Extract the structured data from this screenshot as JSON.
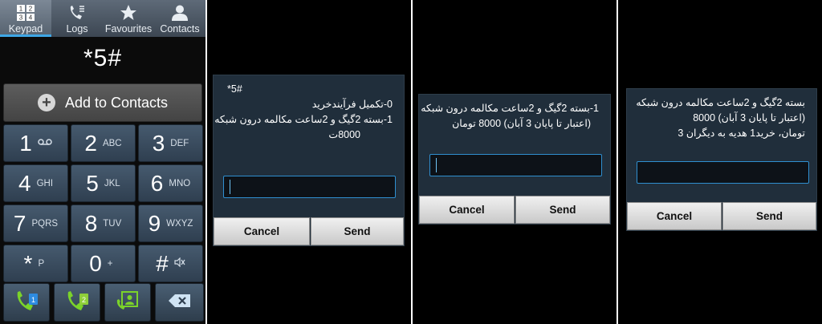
{
  "dialer": {
    "tabs": [
      {
        "label": "Keypad",
        "icon": "keypad-icon",
        "active": true
      },
      {
        "label": "Logs",
        "icon": "logs-icon",
        "active": false
      },
      {
        "label": "Favourites",
        "icon": "star-icon",
        "active": false
      },
      {
        "label": "Contacts",
        "icon": "person-icon",
        "active": false
      }
    ],
    "number": "*5#",
    "add_contacts_label": "Add to Contacts",
    "keys": [
      {
        "digit": "1",
        "letters": "voicemail"
      },
      {
        "digit": "2",
        "letters": "ABC"
      },
      {
        "digit": "3",
        "letters": "DEF"
      },
      {
        "digit": "4",
        "letters": "GHI"
      },
      {
        "digit": "5",
        "letters": "JKL"
      },
      {
        "digit": "6",
        "letters": "MNO"
      },
      {
        "digit": "7",
        "letters": "PQRS"
      },
      {
        "digit": "8",
        "letters": "TUV"
      },
      {
        "digit": "9",
        "letters": "WXYZ"
      },
      {
        "digit": "*",
        "letters": "P"
      },
      {
        "digit": "0",
        "letters": "+"
      },
      {
        "digit": "#",
        "letters": "mute"
      }
    ],
    "actions": [
      {
        "name": "call-sim1-button",
        "icon": "phone-sim1-icon",
        "badge": "1"
      },
      {
        "name": "call-sim2-button",
        "icon": "phone-sim2-icon",
        "badge": "2"
      },
      {
        "name": "video-call-button",
        "icon": "video-call-icon"
      },
      {
        "name": "backspace-button",
        "icon": "backspace-icon"
      }
    ],
    "colors": {
      "accent": "#3fa7e6",
      "call_green": "#7bd32a"
    }
  },
  "dialogs": [
    {
      "lines": [
        "*5#",
        "0-تکمیل فرآیندخرید",
        "1-بسته 2گیگ و 2ساعت مکالمه درون شبکه",
        "8000ت"
      ],
      "cancel": "Cancel",
      "send": "Send"
    },
    {
      "lines": [
        "1-بسته 2گیگ و 2ساعت مکالمه درون شبکه",
        "(اعتبار تا پایان 3 آبان) 8000 تومان"
      ],
      "cancel": "Cancel",
      "send": "Send"
    },
    {
      "lines": [
        "بسته 2گیگ و 2ساعت مکالمه درون شبکه",
        "(اعتبار تا پایان 3 آبان) 8000",
        "تومان، خرید1 هدیه به دیگران 3"
      ],
      "cancel": "Cancel",
      "send": "Send"
    }
  ]
}
